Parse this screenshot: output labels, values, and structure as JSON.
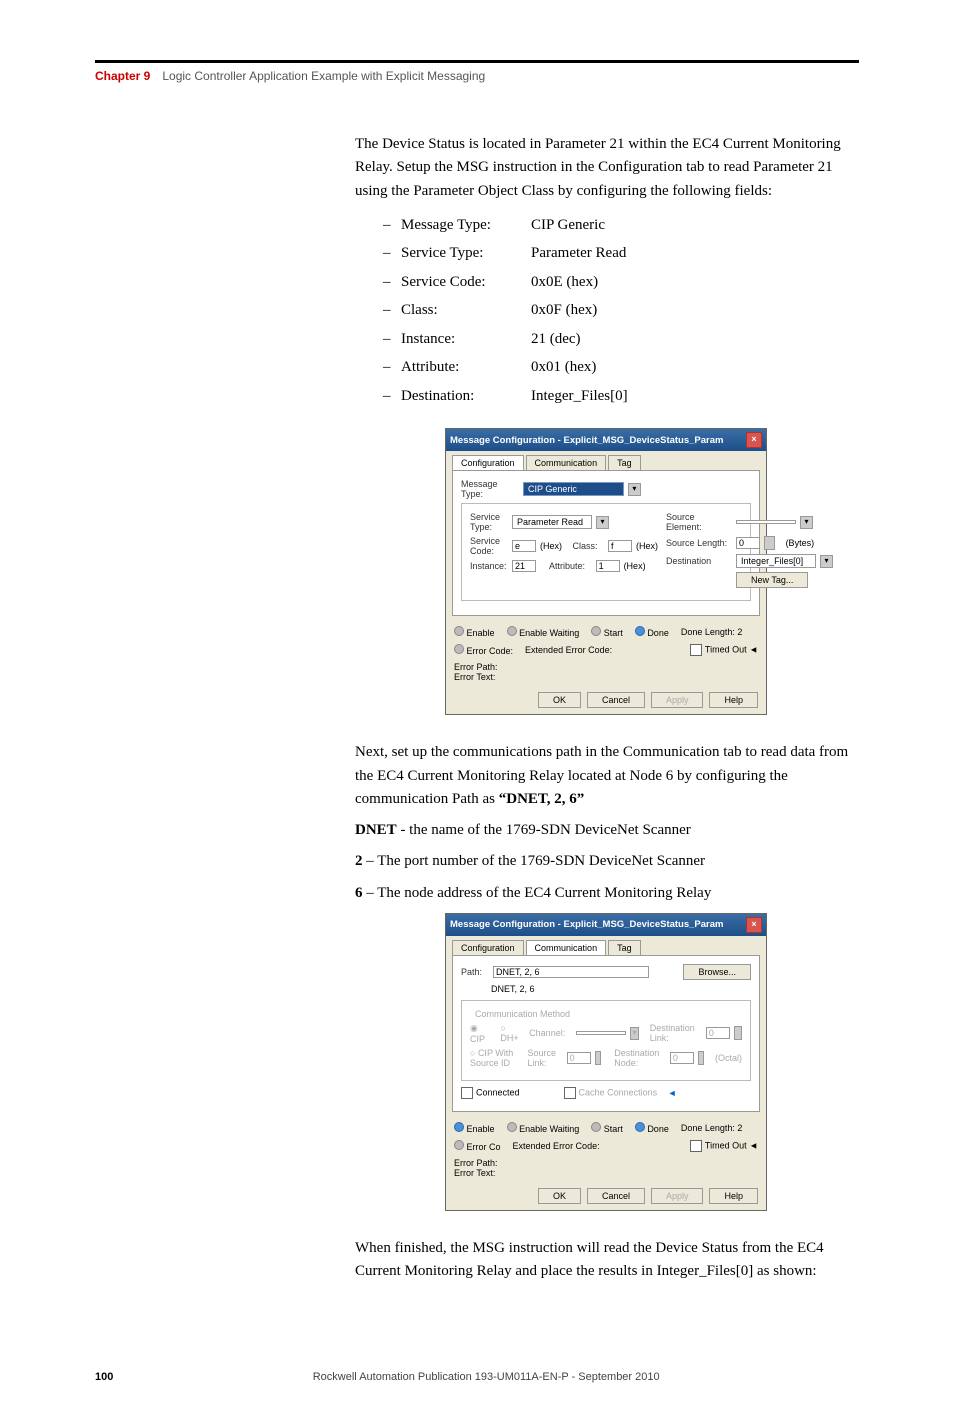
{
  "header": {
    "chapter": "Chapter 9",
    "title": "Logic Controller Application Example with Explicit Messaging"
  },
  "body": {
    "p1": "The Device Status is located in Parameter 21 within the EC4 Current Monitoring Relay.  Setup the MSG instruction in the Configuration tab to read Parameter 21 using the Parameter Object Class by configuring the following fields:",
    "fields": [
      {
        "k": "Message Type:",
        "v": "CIP Generic"
      },
      {
        "k": "Service Type:",
        "v": "Parameter Read"
      },
      {
        "k": "Service Code:",
        "v": "0x0E (hex)"
      },
      {
        "k": "Class:",
        "v": "0x0F (hex)"
      },
      {
        "k": "Instance:",
        "v": "21 (dec)"
      },
      {
        "k": "Attribute:",
        "v": "0x01 (hex)"
      },
      {
        "k": "Destination:",
        "v": "Integer_Files[0]"
      }
    ],
    "p2a": "Next, set up the communications path in the Communication tab to read data from the EC4 Current Monitoring Relay located at Node 6 by configuring the communication Path as ",
    "p2b": "“DNET, 2, 6”",
    "dnet": {
      "k": "DNET",
      "v": " - the name of the 1769-SDN DeviceNet Scanner"
    },
    "two": {
      "k": "2",
      "v": " – The port number of the 1769-SDN DeviceNet Scanner"
    },
    "six": {
      "k": "6",
      "v": " – The node address of the EC4 Current Monitoring Relay"
    },
    "p3": "When finished, the MSG instruction will read the Device Status from the EC4 Current Monitoring Relay and place the results in Integer_Files[0] as shown:"
  },
  "dlg1": {
    "title": "Message Configuration - Explicit_MSG_DeviceStatus_Param",
    "tabs": [
      "Configuration",
      "Communication",
      "Tag"
    ],
    "msgType": {
      "label": "Message Type:",
      "value": "CIP Generic"
    },
    "svcType": {
      "label": "Service Type:",
      "value": "Parameter Read"
    },
    "svcCode": {
      "label": "Service Code:",
      "value": "e"
    },
    "cls": {
      "label": "Class:",
      "value": "f"
    },
    "inst": {
      "label": "Instance:",
      "value": "21"
    },
    "attr": {
      "label": "Attribute:",
      "value": "1"
    },
    "hex": "(Hex)",
    "srcElem": "Source Element:",
    "srcLen": {
      "label": "Source Length:",
      "value": "0",
      "unit": "(Bytes)"
    },
    "dest": {
      "label": "Destination",
      "value": "Integer_Files[0]"
    },
    "newTag": "New Tag...",
    "status": {
      "enable": "Enable",
      "enableWaiting": "Enable Waiting",
      "start": "Start",
      "done": "Done",
      "doneLen": "Done Length: 2",
      "errCode": "Error Code:",
      "extErr": "Extended Error Code:",
      "timed": "Timed Out ◄",
      "errPath": "Error Path:",
      "errText": "Error Text:"
    },
    "buttons": [
      "OK",
      "Cancel",
      "Apply",
      "Help"
    ]
  },
  "dlg2": {
    "title": "Message Configuration - Explicit_MSG_DeviceStatus_Param",
    "tabs": [
      "Configuration",
      "Communication",
      "Tag"
    ],
    "path": {
      "label": "Path:",
      "value": "DNET, 2, 6",
      "echo": "DNET, 2, 6"
    },
    "browse": "Browse...",
    "commMethod": "Communication Method",
    "cip": "CIP",
    "dh": "DH+",
    "channel": "Channel:",
    "destLink": {
      "label": "Destination Link:",
      "value": "0"
    },
    "cipSrc": "CIP With Source ID",
    "srcLink": {
      "label": "Source Link:",
      "value": "0"
    },
    "destNode": {
      "label": "Destination Node:",
      "value": "0"
    },
    "octal": "(Octal)",
    "connected": "Connected",
    "cache": "Cache Connections",
    "status": {
      "errCode": "Error Co"
    }
  },
  "footer": {
    "page": "100",
    "pub": "Rockwell Automation Publication 193-UM011A-EN-P - September 2010"
  }
}
